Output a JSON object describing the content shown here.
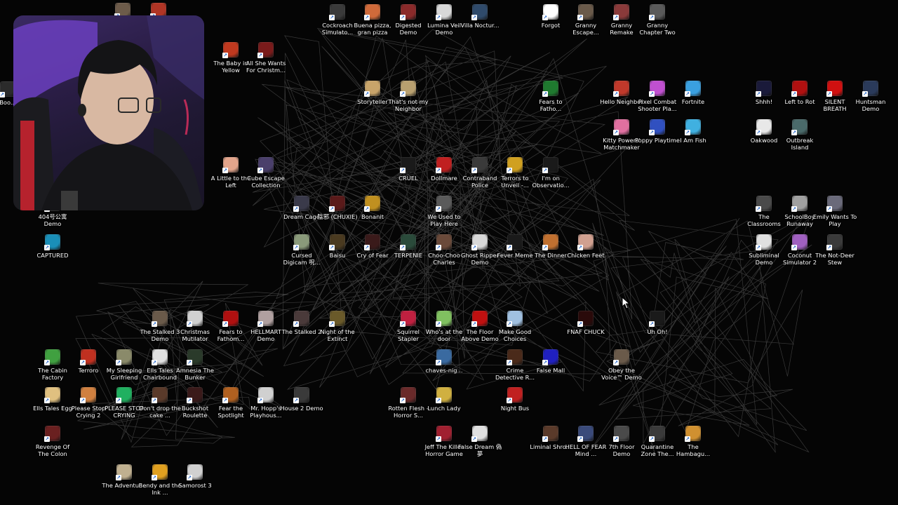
{
  "desktop": {
    "icons": [
      {
        "label": "",
        "color": "#6d5b4a"
      },
      {
        "label": "",
        "color": "#b03525"
      },
      {
        "label": "Boo...",
        "color": "#2b2b2b"
      },
      {
        "label": "The Baby in Yellow",
        "color": "#c0391f"
      },
      {
        "label": "All She Wants For Christm...",
        "color": "#7a1b1b"
      },
      {
        "label": "A Little to the Left",
        "color": "#e2a48b"
      },
      {
        "label": "Cube Escape Collection",
        "color": "#4a3f6b"
      },
      {
        "label": "404号公寓 Demo",
        "color": "#2c2c2c"
      },
      {
        "label": "CAPTURED",
        "color": "#1a8fb8"
      },
      {
        "label": "Cockroach Simulato...",
        "color": "#3a3a3a"
      },
      {
        "label": "Buena pizza, gran pizza",
        "color": "#d06a3a"
      },
      {
        "label": "Digested Demo",
        "color": "#8a2a2a"
      },
      {
        "label": "Lumina Veil Demo",
        "color": "#d8d8d8"
      },
      {
        "label": "Villa Noctur...",
        "color": "#2f4a6a"
      },
      {
        "label": "Forgot",
        "color": "#ffffff"
      },
      {
        "label": "Granny Escape...",
        "color": "#6a5a4a"
      },
      {
        "label": "Granny Remake",
        "color": "#8a3a3a"
      },
      {
        "label": "Granny Chapter Two",
        "color": "#5a5a5a"
      },
      {
        "label": "Storyteller",
        "color": "#c8a46a"
      },
      {
        "label": "That's not my Neighbor",
        "color": "#b8a070"
      },
      {
        "label": "Fears to Fatho...",
        "color": "#1f7a2f"
      },
      {
        "label": "Hello Neighbor",
        "color": "#c0392b"
      },
      {
        "label": "Pixel Combat Shooter Pla...",
        "color": "#c050d0"
      },
      {
        "label": "Fortnite",
        "color": "#3aa0e0"
      },
      {
        "label": "Shhh!",
        "color": "#1a1a3a"
      },
      {
        "label": "Left to Rot",
        "color": "#b01010"
      },
      {
        "label": "SILENT BREATH",
        "color": "#d01010"
      },
      {
        "label": "Huntsman Demo",
        "color": "#2a3a5a"
      },
      {
        "label": "Kitty Powers' Matchmaker",
        "color": "#e070a0"
      },
      {
        "label": "Poppy Playtime",
        "color": "#3050c0"
      },
      {
        "label": "I Am Fish",
        "color": "#40b0e0"
      },
      {
        "label": "Oakwood",
        "color": "#e8e8e8"
      },
      {
        "label": "Outbreak Island",
        "color": "#4a6a6a"
      },
      {
        "label": "CRUEL",
        "color": "#1a1a1a"
      },
      {
        "label": "Dollmare",
        "color": "#c02020"
      },
      {
        "label": "Contraband Police",
        "color": "#3a3a3a"
      },
      {
        "label": "Terrors to Unveil -...",
        "color": "#d0a020"
      },
      {
        "label": "I'm on Observatio...",
        "color": "#1a1a1a"
      },
      {
        "label": "Dream Cage",
        "color": "#3a3a4a"
      },
      {
        "label": "陰邪 (CHUXIE)",
        "color": "#5a1a1a"
      },
      {
        "label": "Bonanit",
        "color": "#c09020"
      },
      {
        "label": "We Used to Play Here",
        "color": "#5a5a5a"
      },
      {
        "label": "The Classrooms",
        "color": "#4a4a4a"
      },
      {
        "label": "SchoolBoy Runaway",
        "color": "#a0a0a0"
      },
      {
        "label": "Emily Wants To Play",
        "color": "#6a6a7a"
      },
      {
        "label": "Cursed Digicam 呪...",
        "color": "#8a9a7a"
      },
      {
        "label": "Baisu",
        "color": "#4a3a20"
      },
      {
        "label": "Cry of Fear",
        "color": "#3a1a1a"
      },
      {
        "label": "TERPENIE",
        "color": "#2a4a3a"
      },
      {
        "label": "Choo-Choo Charles",
        "color": "#6a4a3a"
      },
      {
        "label": "Ghost Ripper Demo",
        "color": "#d8d8d8"
      },
      {
        "label": "Fever Meme",
        "color": "#1a1a1a"
      },
      {
        "label": "The Dinner",
        "color": "#c07030"
      },
      {
        "label": "Chicken Feet",
        "color": "#d0a090"
      },
      {
        "label": "Subliminal Demo",
        "color": "#e0e0e0"
      },
      {
        "label": "Coconut Simulator 2",
        "color": "#a060c0"
      },
      {
        "label": "The Not-Deer Stew",
        "color": "#3a3a3a"
      },
      {
        "label": "The Stalked 3 Demo",
        "color": "#6a5a4a"
      },
      {
        "label": "Christmas Mutilator",
        "color": "#d0d0d0"
      },
      {
        "label": "Fears to Fathom...",
        "color": "#b01010"
      },
      {
        "label": "HELLMART Demo",
        "color": "#b0a0a0"
      },
      {
        "label": "The Stalked 2",
        "color": "#4a3a3a"
      },
      {
        "label": "Night of the Extinct",
        "color": "#6a5a2a"
      },
      {
        "label": "Squirrel Stapler",
        "color": "#c02040"
      },
      {
        "label": "Who's at the door",
        "color": "#80c060"
      },
      {
        "label": "The Floor Above Demo",
        "color": "#c01010"
      },
      {
        "label": "Make Good Choices",
        "color": "#a0c0e0"
      },
      {
        "label": "FNAF CHUCK",
        "color": "#2a0a0a"
      },
      {
        "label": "Uh Oh!",
        "color": "#1a1a1a"
      },
      {
        "label": "The Cabin Factory",
        "color": "#40a040"
      },
      {
        "label": "Terroro",
        "color": "#c03020"
      },
      {
        "label": "My Sleeping Girlfriend",
        "color": "#8a8a6a"
      },
      {
        "label": "Ells Tales Chairbound",
        "color": "#e0e0e0"
      },
      {
        "label": "Amnesia The Bunker",
        "color": "#2a3a2a"
      },
      {
        "label": "chaves-nig...",
        "color": "#3a6aa0"
      },
      {
        "label": "Crime Detective R...",
        "color": "#4a2a1a"
      },
      {
        "label": "False Mall",
        "color": "#2020c0"
      },
      {
        "label": "Obey the Voice™ Demo",
        "color": "#6a5a4a"
      },
      {
        "label": "Ells Tales Egg",
        "color": "#e0c080"
      },
      {
        "label": "Please Stop Crying 2",
        "color": "#d08040"
      },
      {
        "label": "PLEASE STOP CRYING",
        "color": "#20b060"
      },
      {
        "label": "Don't drop the cake ...",
        "color": "#5a3a2a"
      },
      {
        "label": "Buckshot Roulette",
        "color": "#3a1a1a"
      },
      {
        "label": "Fear the Spotlight",
        "color": "#b06020"
      },
      {
        "label": "Mr. Hopp's Playhous...",
        "color": "#d0d0d0"
      },
      {
        "label": "House 2 Demo",
        "color": "#3a3a3a"
      },
      {
        "label": "Rotten Flesh - Horror S...",
        "color": "#6a2a2a"
      },
      {
        "label": "Lunch Lady",
        "color": "#d0b040"
      },
      {
        "label": "Night Bus",
        "color": "#c02020"
      },
      {
        "label": "Revenge Of The Colon",
        "color": "#6a2020"
      },
      {
        "label": "Jeff The Killer Horror Game",
        "color": "#a02030"
      },
      {
        "label": "False Dream 偽夢",
        "color": "#e0e0e0"
      },
      {
        "label": "Liminal Shro...",
        "color": "#5a3a2a"
      },
      {
        "label": "HELL OF FEAR Mind ...",
        "color": "#3a4a7a"
      },
      {
        "label": "7th Floor Demo",
        "color": "#4a4a4a"
      },
      {
        "label": "Quarantine Zone The...",
        "color": "#3a3a3a"
      },
      {
        "label": "The Hambagu...",
        "color": "#d09030"
      },
      {
        "label": "The Adventur...",
        "color": "#c0b090"
      },
      {
        "label": "Bendy and the Ink ...",
        "color": "#e0a020"
      },
      {
        "label": "Samorost 3",
        "color": "#d0d0d0"
      }
    ]
  }
}
